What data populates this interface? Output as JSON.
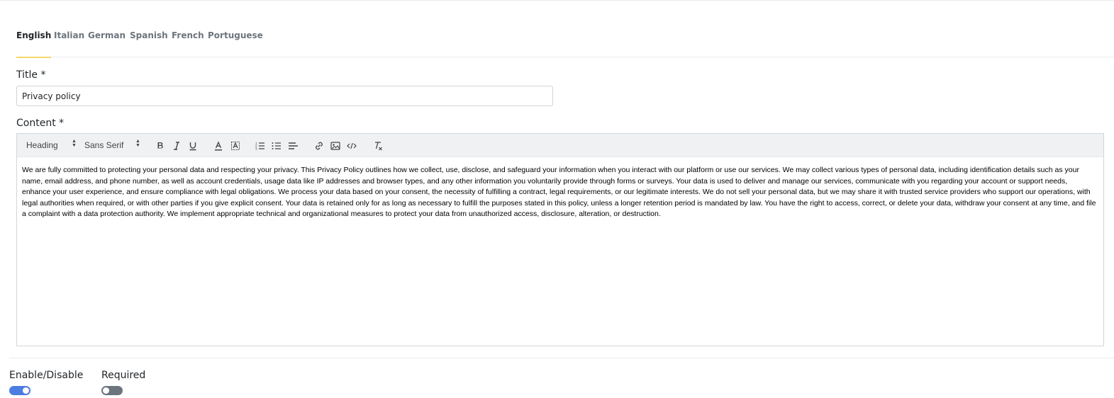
{
  "tabs": [
    {
      "label": "English",
      "active": true
    },
    {
      "label": "Italian",
      "active": false
    },
    {
      "label": "German",
      "active": false
    },
    {
      "label": "Spanish",
      "active": false
    },
    {
      "label": "French",
      "active": false
    },
    {
      "label": "Portuguese",
      "active": false
    }
  ],
  "form": {
    "title_label": "Title *",
    "title_value": "Privacy policy",
    "content_label": "Content *"
  },
  "toolbar": {
    "heading_select": "Heading",
    "font_select": "Sans Serif",
    "icons": [
      "bold-icon",
      "italic-icon",
      "underline-icon",
      "text-color-icon",
      "background-color-icon",
      "ordered-list-icon",
      "bullet-list-icon",
      "align-icon",
      "link-icon",
      "image-icon",
      "code-icon",
      "clear-format-icon"
    ]
  },
  "editor": {
    "content": "We are fully committed to protecting your personal data and respecting your privacy. This Privacy Policy outlines how we collect, use, disclose, and safeguard your information when you interact with our platform or use our services. We may collect various types of personal data, including identification details such as your name, email address, and phone number, as well as account credentials, usage data like IP addresses and browser types, and any other information you voluntarily provide through forms or surveys. Your data is used to deliver and manage our services, communicate with you regarding your account or support needs, enhance your user experience, and ensure compliance with legal obligations. We process your data based on your consent, the necessity of fulfilling a contract, legal requirements, or our legitimate interests. We do not sell your personal data, but we may share it with trusted service providers who support our operations, with legal authorities when required, or with other parties if you give explicit consent. Your data is retained only for as long as necessary to fulfill the purposes stated in this policy, unless a longer retention period is mandated by law. You have the right to access, correct, or delete your data, withdraw your consent at any time, and file a complaint with a data protection authority. We implement appropriate technical and organizational measures to protect your data from unauthorized access, disclosure, alteration, or destruction."
  },
  "toggles": {
    "enable_label": "Enable/Disable",
    "enable_state": true,
    "required_label": "Required",
    "required_state": false
  },
  "colors": {
    "active_tab_underline": "#f5d76e",
    "toggle_on": "#4c7de0",
    "toggle_off": "#6c757d"
  }
}
